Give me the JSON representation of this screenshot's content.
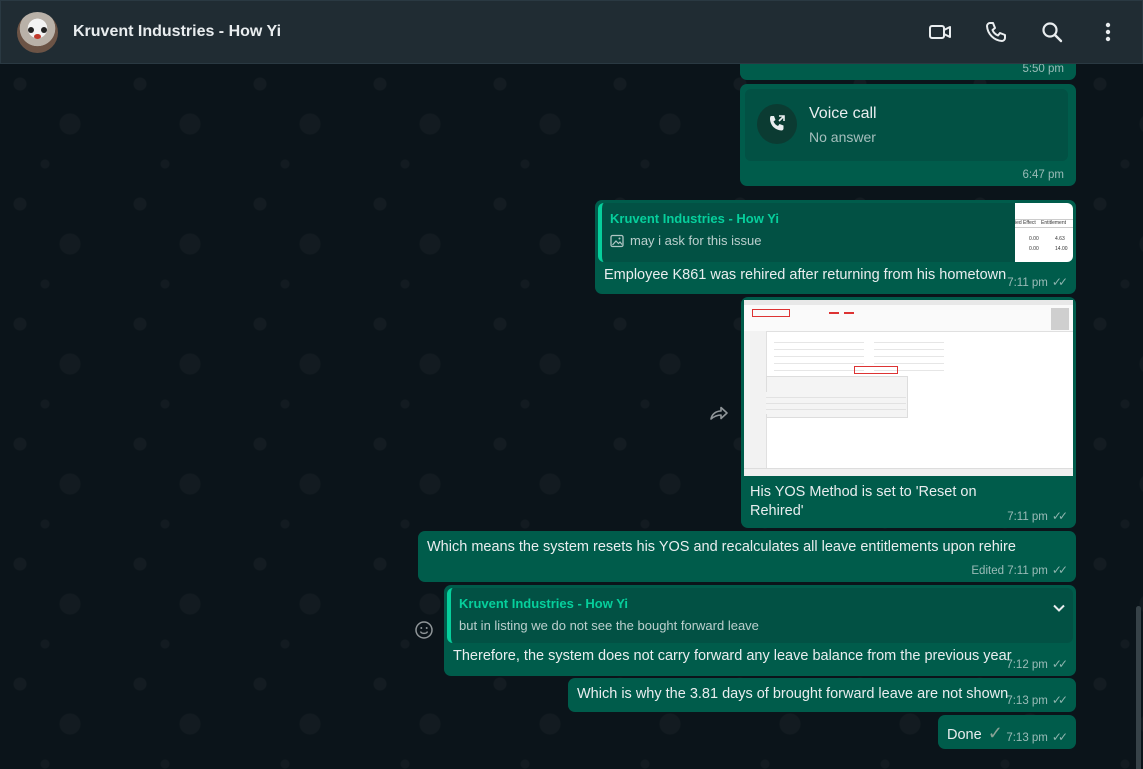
{
  "header": {
    "title": "Kruvent Industries - How Yi",
    "icons": [
      "video-call-icon",
      "phone-icon",
      "search-icon",
      "more-vert-icon"
    ]
  },
  "messages": {
    "m0": {
      "time": "5:50 pm"
    },
    "voice_call": {
      "title": "Voice call",
      "status": "No answer",
      "time": "6:47 pm"
    },
    "m2": {
      "quote_author": "Kruvent Industries - How Yi",
      "quote_text": "may i ask for this issue",
      "thumb_header": [
        "ied Effect",
        "Entitlement"
      ],
      "thumb_rows": [
        [
          "0.00",
          "4.63"
        ],
        [
          "0.00",
          "14.00"
        ]
      ],
      "text": "Employee K861 was rehired after returning from his hometown",
      "time": "7:11 pm"
    },
    "m3": {
      "text_line1": "His YOS Method is set to 'Reset on",
      "text_line2": "Rehired'",
      "time": "7:11 pm"
    },
    "m4": {
      "text": "Which means the system resets his YOS and recalculates all leave entitlements upon rehire",
      "edited": "Edited",
      "time": "7:11 pm"
    },
    "m5": {
      "quote_author": "Kruvent Industries - How Yi",
      "quote_text": "but in listing we do not see the bought forward leave",
      "text": "Therefore, the system does not carry forward any leave balance from the previous year",
      "time": "7:12 pm"
    },
    "m6": {
      "text": "Which is why the 3.81 days of brought forward leave are not shown",
      "time": "7:13 pm"
    },
    "m7": {
      "text": "Done",
      "emoji": "✓",
      "time": "7:13 pm"
    }
  },
  "colors": {
    "outgoing_bubble": "#005c4b",
    "quote_bg": "#025144",
    "accent": "#06cf9c",
    "header_bg": "#202c33",
    "chat_bg": "#0b141a"
  }
}
